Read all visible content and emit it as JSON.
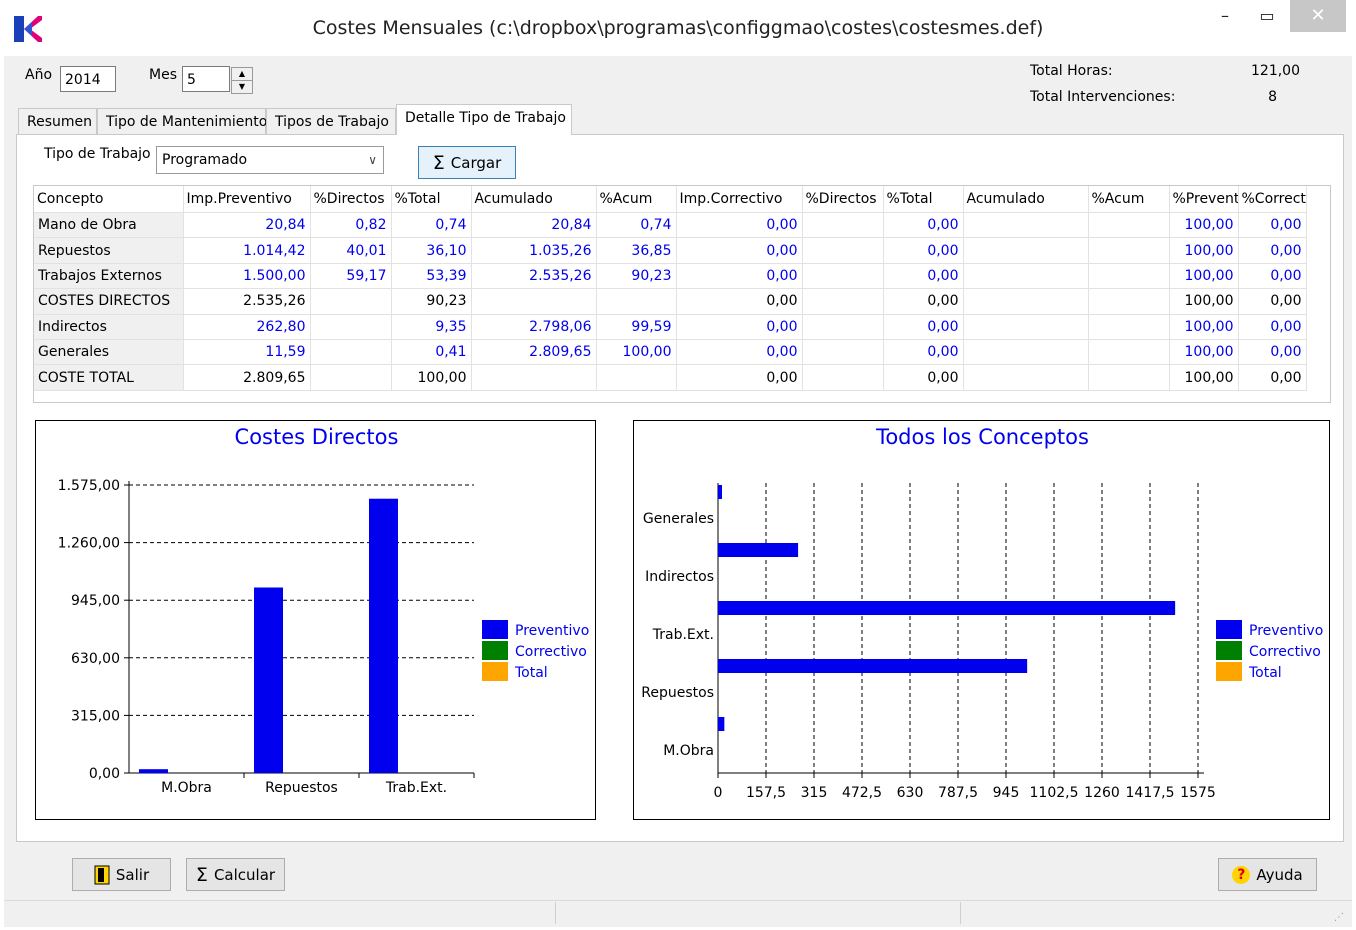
{
  "window": {
    "title": "Costes Mensuales (c:\\dropbox\\programas\\configgmao\\costes\\costesmes.def)",
    "minimize": "–",
    "maximize": "▭",
    "close": "✕"
  },
  "header": {
    "year_label": "Año",
    "year_value": "2014",
    "month_label": "Mes",
    "month_value": "5",
    "total_hours_label": "Total Horas:",
    "total_hours_value": "121,00",
    "total_interventions_label": "Total Intervenciones:",
    "total_interventions_value": "8"
  },
  "tabs": [
    "Resumen",
    "Tipo de Mantenimiento",
    "Tipos de Trabajo",
    "Detalle Tipo de Trabajo"
  ],
  "filter": {
    "label": "Tipo de Trabajo",
    "value": "Programado",
    "load_button": "Cargar"
  },
  "table": {
    "columns": [
      "Concepto",
      "Imp.Preventivo",
      "%Directos",
      "%Total",
      "Acumulado",
      "%Acum",
      "Imp.Correctivo",
      "%Directos",
      "%Total",
      "Acumulado",
      "%Acum",
      "%Preventi",
      "%Correct"
    ],
    "rows": [
      {
        "cells": [
          "Mano de Obra",
          "20,84",
          "0,82",
          "0,74",
          "20,84",
          "0,74",
          "0,00",
          "",
          "0,00",
          "",
          "",
          "100,00",
          "0,00"
        ],
        "color": "blue"
      },
      {
        "cells": [
          "Repuestos",
          "1.014,42",
          "40,01",
          "36,10",
          "1.035,26",
          "36,85",
          "0,00",
          "",
          "0,00",
          "",
          "",
          "100,00",
          "0,00"
        ],
        "color": "blue"
      },
      {
        "cells": [
          "Trabajos Externos",
          "1.500,00",
          "59,17",
          "53,39",
          "2.535,26",
          "90,23",
          "0,00",
          "",
          "0,00",
          "",
          "",
          "100,00",
          "0,00"
        ],
        "color": "blue"
      },
      {
        "cells": [
          "COSTES DIRECTOS",
          "2.535,26",
          "",
          "90,23",
          "",
          "",
          "0,00",
          "",
          "0,00",
          "",
          "",
          "100,00",
          "0,00"
        ],
        "color": "black"
      },
      {
        "cells": [
          "Indirectos",
          "262,80",
          "",
          "9,35",
          "2.798,06",
          "99,59",
          "0,00",
          "",
          "0,00",
          "",
          "",
          "100,00",
          "0,00"
        ],
        "color": "blue"
      },
      {
        "cells": [
          "Generales",
          "11,59",
          "",
          "0,41",
          "2.809,65",
          "100,00",
          "0,00",
          "",
          "0,00",
          "",
          "",
          "100,00",
          "0,00"
        ],
        "color": "blue"
      },
      {
        "cells": [
          "COSTE TOTAL",
          "2.809,65",
          "",
          "100,00",
          "",
          "",
          "0,00",
          "",
          "0,00",
          "",
          "",
          "100,00",
          "0,00"
        ],
        "color": "black"
      }
    ]
  },
  "legend": {
    "items": [
      "Preventivo",
      "Correctivo",
      "Total"
    ],
    "colors": [
      "#0000ee",
      "#008000",
      "#ffa500"
    ]
  },
  "chart_data": [
    {
      "type": "bar",
      "title": "Costes Directos",
      "categories": [
        "M.Obra",
        "Repuestos",
        "Trab.Ext."
      ],
      "series": [
        {
          "name": "Preventivo",
          "values": [
            20.84,
            1014.42,
            1500.0
          ],
          "color": "#0000ee"
        },
        {
          "name": "Correctivo",
          "values": [
            0,
            0,
            0
          ],
          "color": "#008000"
        },
        {
          "name": "Total",
          "values": [
            0,
            0,
            0
          ],
          "color": "#ffa500"
        }
      ],
      "ylim": [
        0,
        1575
      ],
      "yticks": [
        "0,00",
        "315,00",
        "630,00",
        "945,00",
        "1.260,00",
        "1.575,00"
      ],
      "grid": true,
      "legend": "right"
    },
    {
      "type": "bar",
      "orientation": "horizontal",
      "title": "Todos los Conceptos",
      "categories": [
        "M.Obra",
        "Repuestos",
        "Trab.Ext.",
        "Indirectos",
        "Generales"
      ],
      "series": [
        {
          "name": "Preventivo",
          "values": [
            20.84,
            1014.42,
            1500.0,
            262.8,
            11.59
          ],
          "color": "#0000ee"
        },
        {
          "name": "Correctivo",
          "values": [
            0,
            0,
            0,
            0,
            0
          ],
          "color": "#008000"
        },
        {
          "name": "Total",
          "values": [
            0,
            0,
            0,
            0,
            0
          ],
          "color": "#ffa500"
        }
      ],
      "xlim": [
        0,
        1575
      ],
      "xticks": [
        "0",
        "157,5",
        "315",
        "472,5",
        "630",
        "787,5",
        "945",
        "1102,5",
        "1260",
        "1417,5",
        "1575"
      ],
      "grid": true,
      "legend": "right"
    }
  ],
  "footer": {
    "exit_button": "Salir",
    "calc_button": "Calcular",
    "help_button": "Ayuda"
  }
}
